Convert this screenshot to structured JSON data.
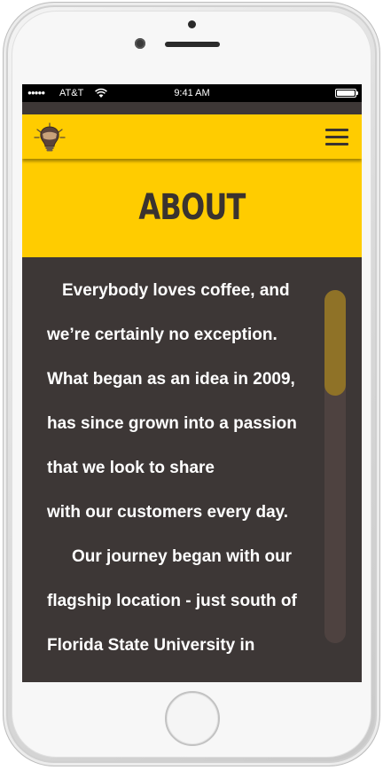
{
  "status_bar": {
    "signal": "●●●●●",
    "carrier": "AT&T",
    "time": "9:41 AM"
  },
  "navbar": {
    "logo_icon": "lightbulb-coffee-logo",
    "menu_icon": "hamburger-menu-icon"
  },
  "page": {
    "title": "ABOUT"
  },
  "about_text": {
    "lines": [
      "Everybody loves coffee,  and",
      "we’re certainly no exception.",
      "What began as an idea in 2009,",
      "has since grown into a passion",
      "that we look to share",
      "with our customers every day.",
      "Our journey began with our",
      "flagship location - just south of",
      "Florida State University in"
    ]
  },
  "colors": {
    "accent": "#ffcc00",
    "background": "#3d3736",
    "text": "#ffffff",
    "scroll_thumb": "#8f7227"
  }
}
